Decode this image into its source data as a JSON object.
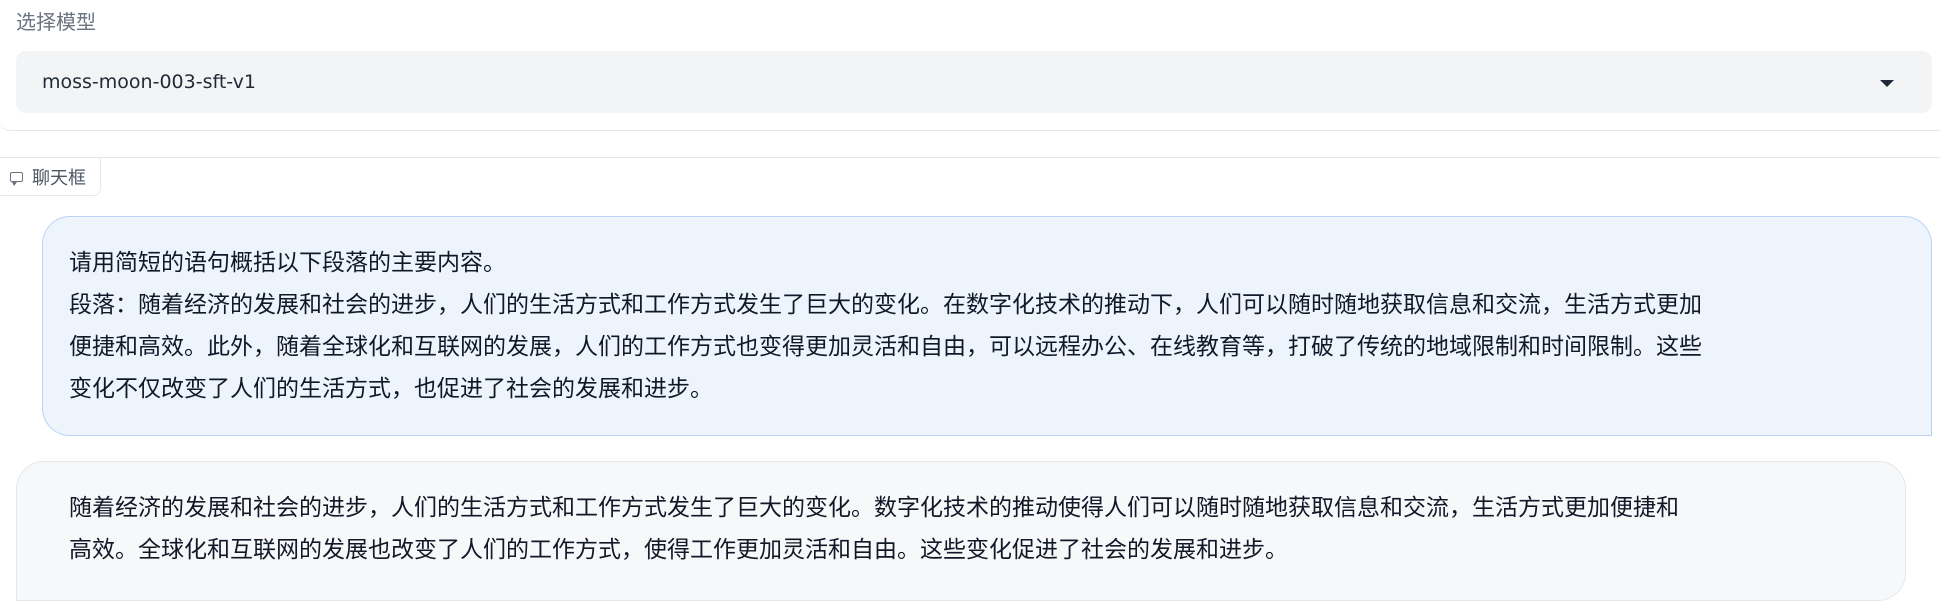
{
  "model_selector": {
    "label": "选择模型",
    "value": "moss-moon-003-sft-v1"
  },
  "chatbot": {
    "label": "聊天框",
    "messages": [
      {
        "role": "user",
        "lines": [
          "请用简短的语句概括以下段落的主要内容。",
          "段落：随着经济的发展和社会的进步，人们的生活方式和工作方式发生了巨大的变化。在数字化技术的推动下，人们可以随时随地获取信息和交流，生活方式更加",
          "便捷和高效。此外，随着全球化和互联网的发展，人们的工作方式也变得更加灵活和自由，可以远程办公、在线教育等，打破了传统的地域限制和时间限制。这些",
          "变化不仅改变了人们的生活方式，也促进了社会的发展和进步。"
        ]
      },
      {
        "role": "bot",
        "lines": [
          "随着经济的发展和社会的进步，人们的生活方式和工作方式发生了巨大的变化。数字化技术的推动使得人们可以随时随地获取信息和交流，生活方式更加便捷和",
          "高效。全球化和互联网的发展也改变了人们的工作方式，使得工作更加灵活和自由。这些变化促进了社会的发展和进步。"
        ]
      }
    ]
  },
  "icons": {
    "dropdown": "chevron-down-icon",
    "chat": "chat-icon"
  },
  "colors": {
    "user_bubble_bg": "#eef4fc",
    "user_bubble_border": "#bcd3f5",
    "bot_bubble_bg": "#f7f8fa",
    "select_bg": "#f3f4f6"
  }
}
